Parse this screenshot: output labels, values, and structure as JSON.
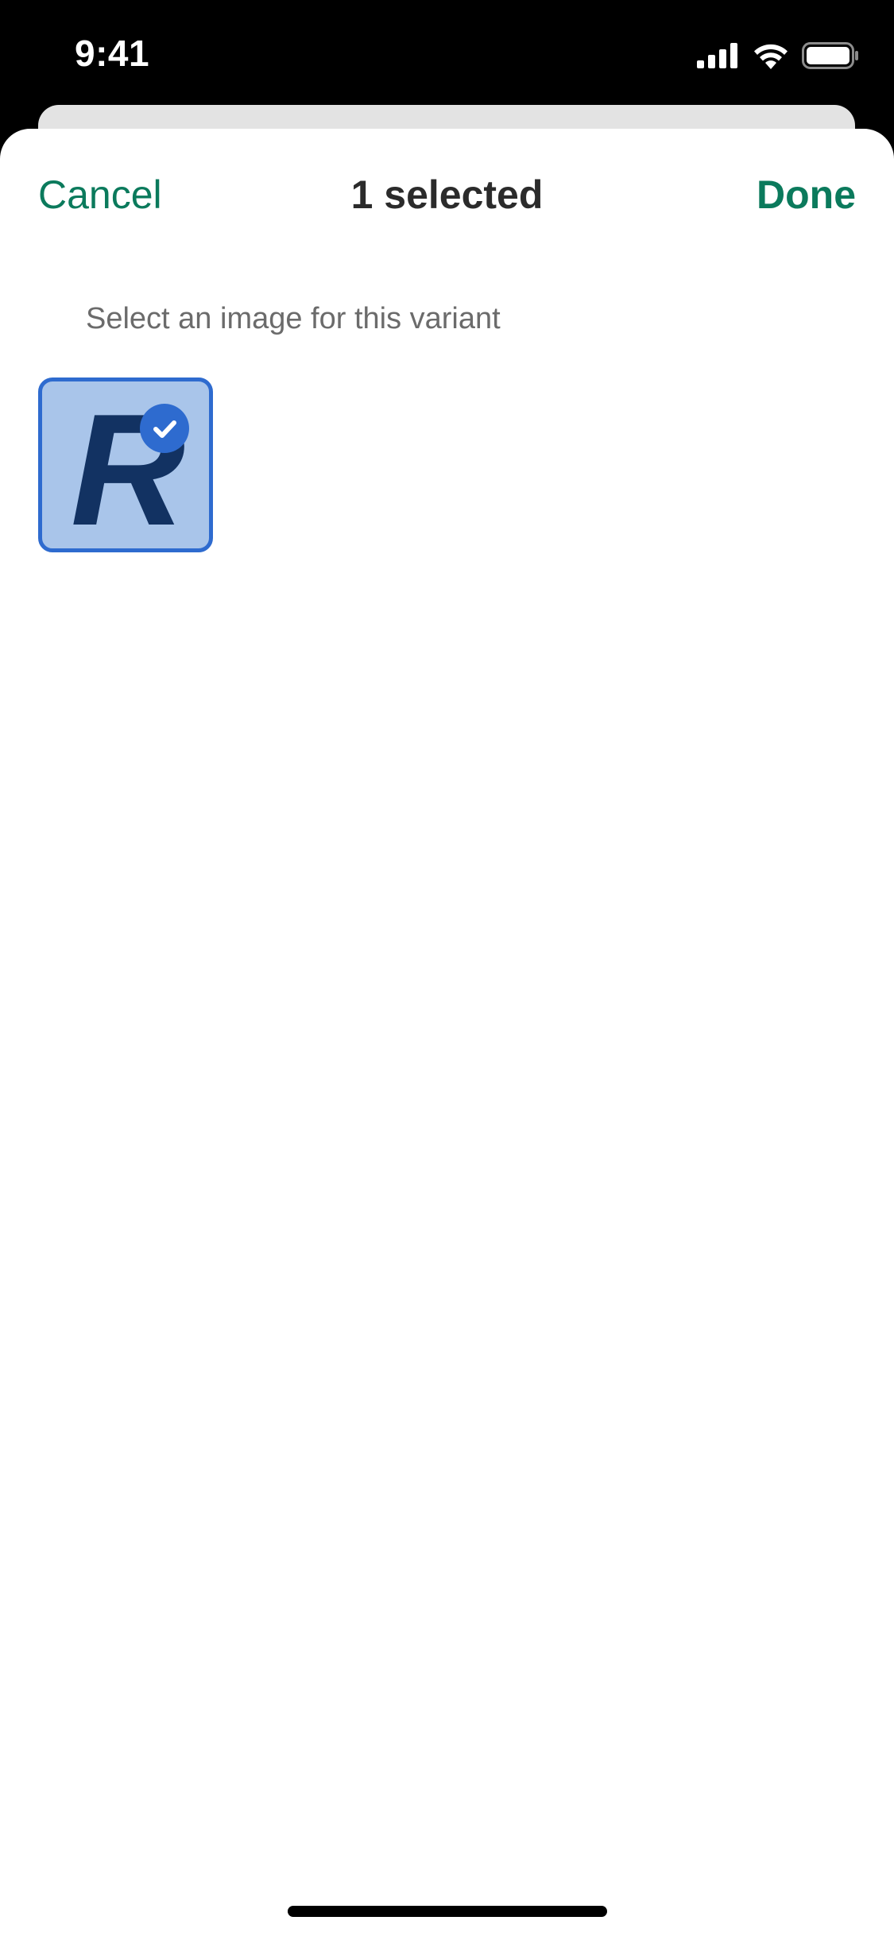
{
  "status_bar": {
    "time": "9:41",
    "icons": [
      "cellular-signal-icon",
      "wifi-icon",
      "battery-icon"
    ]
  },
  "nav": {
    "cancel_label": "Cancel",
    "title": "1 selected",
    "done_label": "Done"
  },
  "content": {
    "instruction": "Select an image for this variant",
    "images": [
      {
        "logo_letter": "R",
        "selected": true
      }
    ]
  },
  "colors": {
    "accent": "#0b7a5c",
    "selection_border": "#2e6bcf",
    "tile_background": "#a9c5ea",
    "logo": "#123262",
    "status_bar_background": "#000000"
  }
}
